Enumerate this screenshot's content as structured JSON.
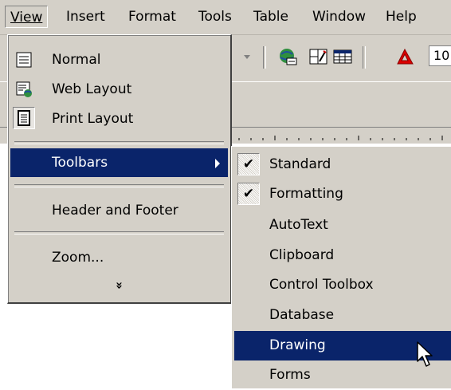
{
  "menubar": {
    "items": [
      {
        "label": "View",
        "active": true
      },
      {
        "label": "Insert"
      },
      {
        "label": "Format"
      },
      {
        "label": "Tools"
      },
      {
        "label": "Table"
      },
      {
        "label": "Window"
      },
      {
        "label": "Help"
      }
    ]
  },
  "toolbar": {
    "zoom_value": "10",
    "icons": [
      "dropdown-arrow-icon",
      "web-globe-icon",
      "drawing-toolbar-icon",
      "table-grid-icon",
      "acrobat-icon"
    ]
  },
  "view_menu": {
    "items": [
      {
        "label": "Normal",
        "icon": "normal-view-icon"
      },
      {
        "label": "Web Layout",
        "icon": "web-layout-icon"
      },
      {
        "label": "Print Layout",
        "icon": "print-layout-icon",
        "pressed": true
      },
      {
        "label": "Toolbars",
        "has_submenu": true,
        "selected": true
      },
      {
        "label": "Header and Footer"
      },
      {
        "label": "Zoom..."
      }
    ],
    "expand_glyph": "»"
  },
  "toolbars_submenu": {
    "items": [
      {
        "label": "Standard",
        "checked": true
      },
      {
        "label": "Formatting",
        "checked": true
      },
      {
        "label": "AutoText"
      },
      {
        "label": "Clipboard"
      },
      {
        "label": "Control Toolbox"
      },
      {
        "label": "Database"
      },
      {
        "label": "Drawing",
        "selected": true
      },
      {
        "label": "Forms"
      }
    ],
    "check_glyph": "✔"
  },
  "colors": {
    "face": "#d4d0c8",
    "highlight": "#0a246a",
    "highlight_text": "#ffffff"
  }
}
